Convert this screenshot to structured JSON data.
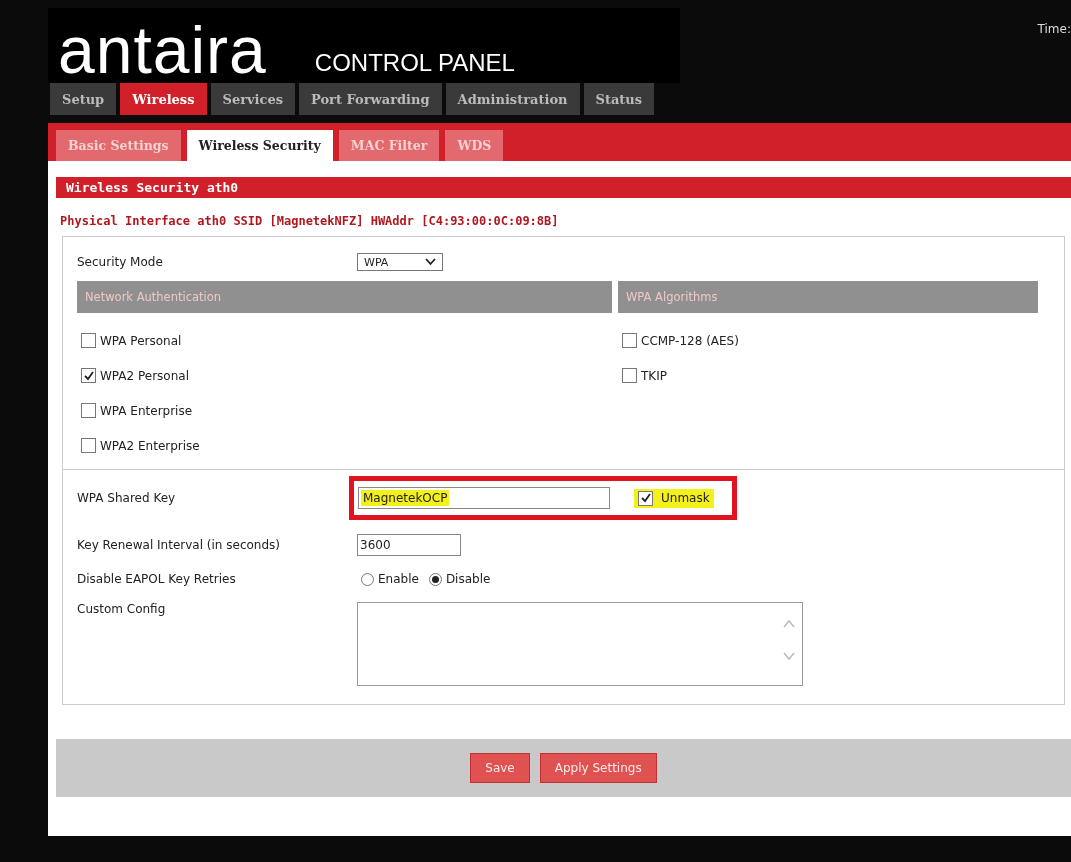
{
  "header": {
    "logo": "antaira",
    "subtitle": "CONTROL PANEL",
    "time_label": "Time:"
  },
  "tabs": [
    {
      "label": "Setup",
      "selected": false
    },
    {
      "label": "Wireless",
      "selected": true
    },
    {
      "label": "Services",
      "selected": false
    },
    {
      "label": "Port Forwarding",
      "selected": false
    },
    {
      "label": "Administration",
      "selected": false
    },
    {
      "label": "Status",
      "selected": false
    }
  ],
  "subtabs": [
    {
      "label": "Basic Settings",
      "selected": false
    },
    {
      "label": "Wireless Security",
      "selected": true
    },
    {
      "label": "MAC Filter",
      "selected": false
    },
    {
      "label": "WDS",
      "selected": false
    }
  ],
  "section_title": "Wireless Security ath0",
  "fieldset_legend": "Physical Interface ath0 SSID [MagnetekNFZ] HWAddr [C4:93:00:0C:09:8B]",
  "security_mode": {
    "label": "Security Mode",
    "value": "WPA"
  },
  "auth_columns": [
    {
      "heading": "Network Authentication",
      "options": [
        {
          "label": "WPA Personal",
          "checked": false
        },
        {
          "label": "WPA2 Personal",
          "checked": true
        },
        {
          "label": "WPA Enterprise",
          "checked": false
        },
        {
          "label": "WPA2 Enterprise",
          "checked": false
        }
      ]
    },
    {
      "heading": "WPA Algorithms",
      "options": [
        {
          "label": "CCMP-128 (AES)",
          "checked": false
        },
        {
          "label": "TKIP",
          "checked": false
        }
      ]
    }
  ],
  "shared_key": {
    "label": "WPA Shared Key",
    "value": "MagnetekOCP",
    "highlighted": true,
    "unmask": {
      "label": "Unmask",
      "checked": true,
      "highlighted": true
    },
    "annotation_box": true
  },
  "renewal": {
    "label": "Key Renewal Interval (in seconds)",
    "value": "3600"
  },
  "eapol": {
    "label": "Disable EAPOL Key Retries",
    "options": [
      {
        "label": "Enable",
        "selected": false
      },
      {
        "label": "Disable",
        "selected": true
      }
    ]
  },
  "custom_config": {
    "label": "Custom Config"
  },
  "buttons": [
    "Save",
    "Apply Settings"
  ]
}
